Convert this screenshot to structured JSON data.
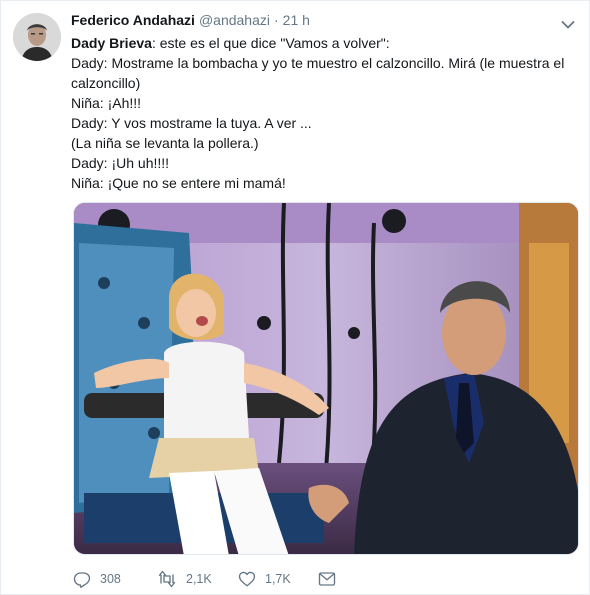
{
  "tweet": {
    "author_name": "Federico Andahazi",
    "handle": "@andahazi",
    "separator": "·",
    "time": "21 h",
    "lines": [
      {
        "bold": "Dady Brieva",
        "text": ": este es el que dice \"Vamos a volver\":"
      },
      {
        "bold": "",
        "text": "Dady: Mostrame la bombacha y yo te muestro el calzoncillo. Mirá (le muestra el calzoncillo)"
      },
      {
        "bold": "",
        "text": "Niña: ¡Ah!!!"
      },
      {
        "bold": "",
        "text": "Dady: Y vos mostrame la tuya. A ver ..."
      },
      {
        "bold": "",
        "text": "(La niña se levanta la pollera.)"
      },
      {
        "bold": "",
        "text": "Dady: ¡Uh uh!!!!"
      },
      {
        "bold": "",
        "text": "Niña: ¡Que no se entere mi mamá!"
      }
    ],
    "replies": "308",
    "retweets": "2,1K",
    "likes": "1,7K"
  },
  "icons": {
    "caret": "chevron-down-icon",
    "reply": "reply-icon",
    "retweet": "retweet-icon",
    "like": "heart-icon",
    "dm": "envelope-icon"
  },
  "colors": {
    "text": "#14171a",
    "secondary": "#657786",
    "border": "#e6ecf0"
  }
}
